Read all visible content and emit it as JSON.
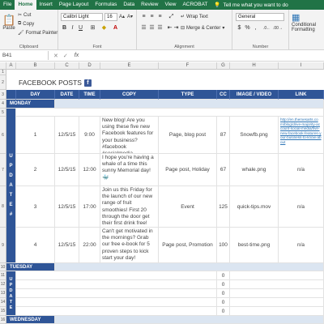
{
  "menu": {
    "file": "File",
    "tabs": [
      "Home",
      "Insert",
      "Page Layout",
      "Formulas",
      "Data",
      "Review",
      "View",
      "ACROBAT"
    ],
    "tellme": "Tell me what you want to do"
  },
  "ribbon": {
    "clipboard": {
      "label": "Clipboard",
      "paste": "Paste",
      "cut": "Cut",
      "copy": "Copy",
      "format_painter": "Format Painter"
    },
    "font": {
      "label": "Font",
      "font_name": "Calibri Light",
      "font_size": "16",
      "bold": "B",
      "italic": "I",
      "underline": "U"
    },
    "alignment": {
      "label": "Alignment",
      "wrap_text": "Wrap Text",
      "merge_center": "Merge & Center"
    },
    "number": {
      "label": "Number",
      "format": "General",
      "currency": "$",
      "percent": "%",
      "comma": ","
    },
    "styles": {
      "conditional": "Conditional",
      "formatting": "Formatting"
    }
  },
  "formula_bar": {
    "namebox": "B41",
    "fx": "fx"
  },
  "columns": [
    "A",
    "B",
    "C",
    "D",
    "E",
    "F",
    "G",
    "H",
    "I"
  ],
  "rows": [
    "1",
    "2",
    "3",
    "4",
    "5",
    "6",
    "7",
    "8",
    "9",
    "10",
    "11",
    "12",
    "13",
    "14",
    "15",
    "16"
  ],
  "sheet": {
    "title": "FACEBOOK POSTS",
    "fb_glyph": "f",
    "headers": [
      "DAY",
      "DATE",
      "TIME",
      "COPY",
      "TYPE",
      "CC",
      "IMAGE / VIDEO",
      "LINK"
    ],
    "days": [
      "MONDAY",
      "TUESDAY",
      "WEDNESDAY"
    ],
    "update_letters": [
      "U",
      "P",
      "D",
      "A",
      "T",
      "E",
      "#"
    ],
    "posts": [
      {
        "num": "1",
        "date": "12/5/15",
        "time": "9:00",
        "copy": "New blog! Are you using these five new Facebook features for your business? #facebook #socialmedia",
        "type": "Page, blog post",
        "cc": "87",
        "image": "Snowfb.png",
        "link": "http://en.themesarts.com/blog/drive-majority-account-social-media/five-new-facebook-features-your-business-to-know-about"
      },
      {
        "num": "2",
        "date": "12/5/15",
        "time": "12:00",
        "copy": "I hope you're having a whale of a time this sunny Memorial day! 🐳",
        "type": "Page post, Holiday",
        "cc": "67",
        "image": "whale.png",
        "link": "n/a"
      },
      {
        "num": "3",
        "date": "12/5/15",
        "time": "17:00",
        "copy": "Join us this Friday for the launch of our new range of fruit smoothies! First 20 through the door get their first drink free!",
        "type": "Event",
        "cc": "125",
        "image": "quick-tips.mov",
        "link": "n/a"
      },
      {
        "num": "4",
        "date": "12/5/15",
        "time": "22:00",
        "copy": "Can't get motivated in the mornings? Grab our free e-book for 5 proven steps to kick start your day!",
        "type": "Page post, Promotion",
        "cc": "100",
        "image": "best-time.png",
        "link": "n/a"
      }
    ],
    "tuesday_cc": [
      "0",
      "0",
      "0",
      "0",
      "0"
    ]
  },
  "colors": {
    "excel_green": "#217346",
    "header_blue": "#2f5597",
    "day_band": "#dbe5f1",
    "link_blue": "#2e75b6",
    "facebook": "#3b5998"
  }
}
